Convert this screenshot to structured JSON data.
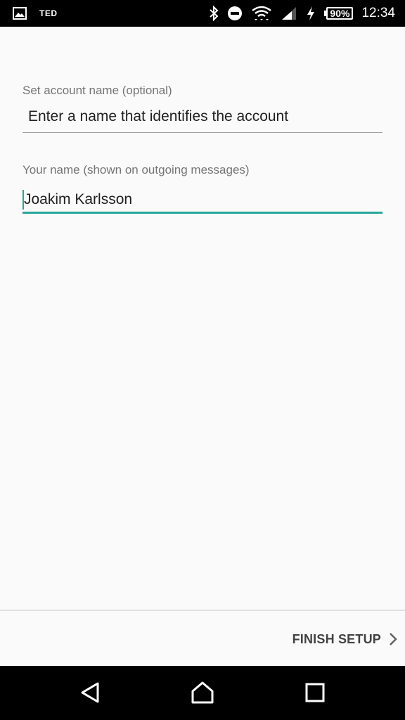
{
  "status_bar": {
    "app_label": "TED",
    "battery_percent": "90%",
    "time": "12:34",
    "icons": [
      "image-icon",
      "bluetooth-icon",
      "do-not-disturb-icon",
      "wifi-icon",
      "signal-icon",
      "charging-icon",
      "battery-icon"
    ]
  },
  "form": {
    "account_name": {
      "label": "Set account name (optional)",
      "placeholder": "Enter a name that identifies the account",
      "value": ""
    },
    "your_name": {
      "label": "Your name (shown on outgoing messages)",
      "value": "Joakim Karlsson"
    }
  },
  "action_bar": {
    "finish_label": "FINISH SETUP",
    "finish_icon": "chevron-right-icon"
  },
  "nav_bar": {
    "buttons": [
      "back-icon",
      "home-icon",
      "recents-icon"
    ]
  },
  "colors": {
    "accent": "#26a69a",
    "status_bar": "#000000",
    "background": "#fafafa"
  }
}
